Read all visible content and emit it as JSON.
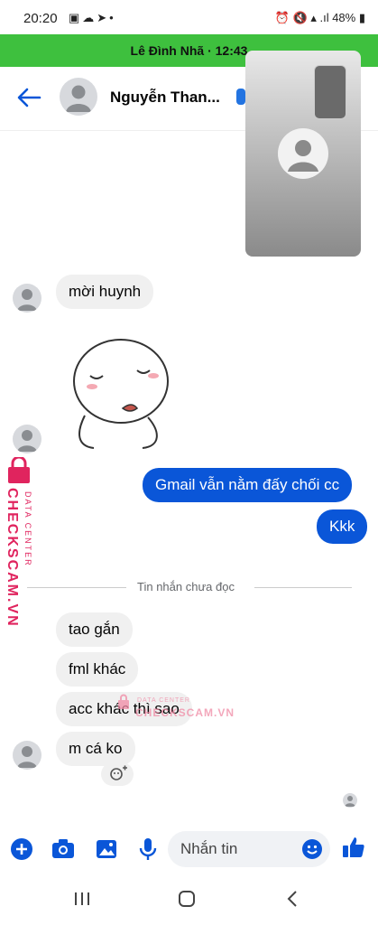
{
  "status_bar": {
    "time": "20:20",
    "battery": "48%"
  },
  "call_banner": {
    "text": "Lê Đình Nhã · 12:43"
  },
  "header": {
    "contact_name": "Nguyễn Than..."
  },
  "messages": {
    "in_1": "mời huynh",
    "out_1": "Gmail vẫn nằm đấy chối cc",
    "out_2": "Kkk",
    "divider": "Tin nhắn chưa đọc",
    "in_2": "tao gắn",
    "in_3": "fml khác",
    "in_4": "acc khác thì sao",
    "in_5": "m cá ko"
  },
  "watermark": {
    "brand": "CHECKSCAM.VN",
    "sub": "DATA CENTER"
  },
  "composer": {
    "placeholder": "Nhắn tin"
  },
  "colors": {
    "accent": "#0a56d8",
    "call_banner": "#3ec03e",
    "watermark": "#e0245e"
  }
}
